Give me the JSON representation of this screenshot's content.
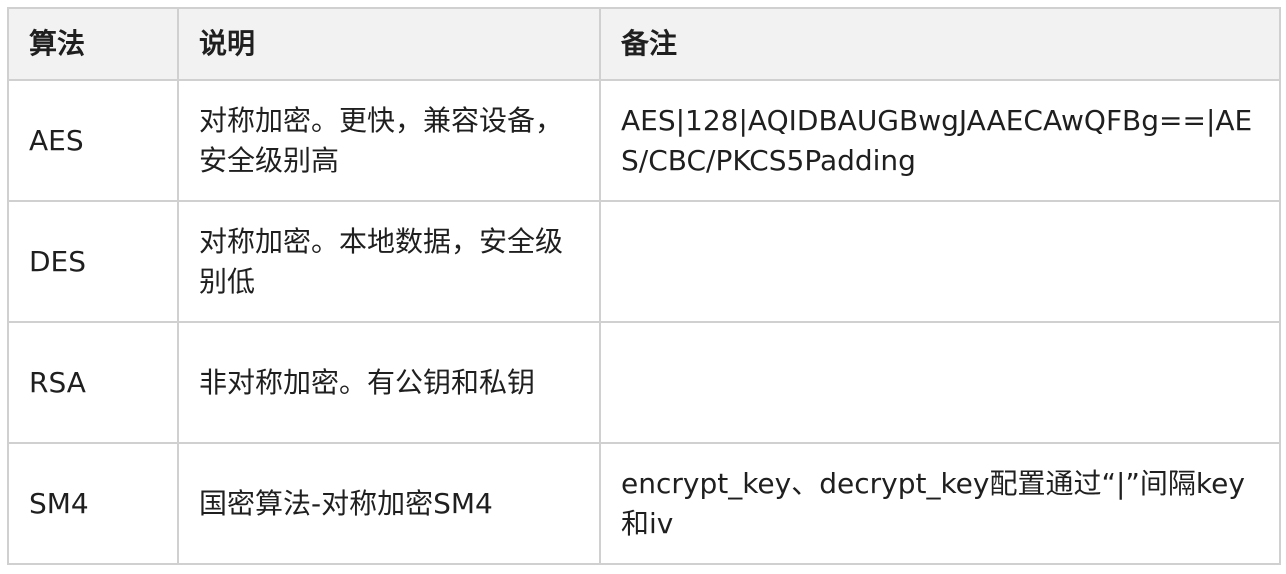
{
  "table": {
    "headers": [
      "算法",
      "说明",
      "备注"
    ],
    "rows": [
      {
        "algorithm": "AES",
        "description": "对称加密。更快，兼容设备，安全级别高",
        "note": "AES|128|AQIDBAUGBwgJAAECAwQFBg==|AES/CBC/PKCS5Padding"
      },
      {
        "algorithm": "DES",
        "description": "对称加密。本地数据，安全级别低",
        "note": ""
      },
      {
        "algorithm": "RSA",
        "description": "非对称加密。有公钥和私钥",
        "note": ""
      },
      {
        "algorithm": "SM4",
        "description": "国密算法-对称加密SM4",
        "note": "encrypt_key、decrypt_key配置通过“|”间隔key和iv"
      }
    ]
  }
}
